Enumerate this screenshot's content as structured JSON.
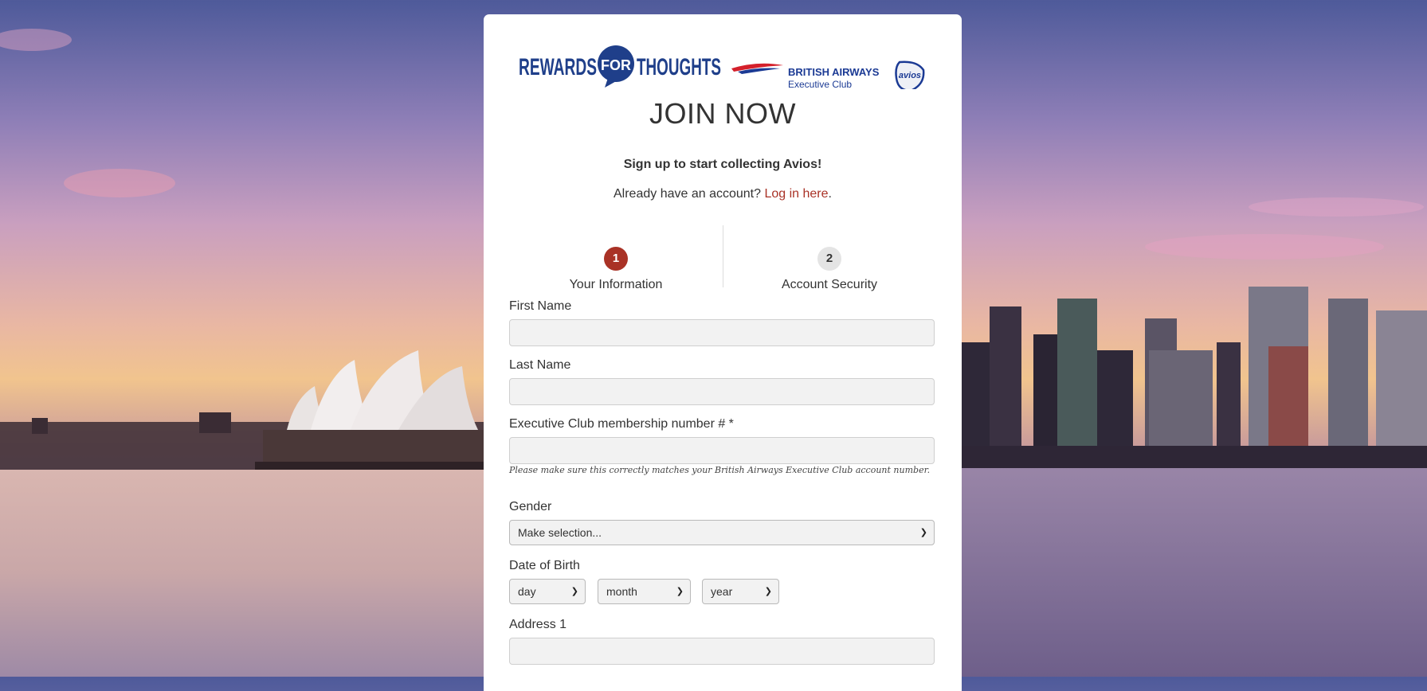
{
  "logos": {
    "rewards_left": "REWARDS",
    "rewards_mid": "FOR",
    "rewards_right": "THOUGHTS",
    "ba_name": "BRITISH AIRWAYS",
    "ba_club": "Executive Club",
    "avios": "avios"
  },
  "page": {
    "title": "JOIN NOW",
    "subtitle": "Sign up to start collecting Avios!",
    "login_prompt": "Already have an account?",
    "login_link": "Log in here",
    "login_suffix": "."
  },
  "steps": [
    {
      "number": "1",
      "label": "Your Information",
      "state": "active"
    },
    {
      "number": "2",
      "label": "Account Security",
      "state": "inactive"
    }
  ],
  "form": {
    "first_name": {
      "label": "First Name",
      "value": ""
    },
    "last_name": {
      "label": "Last Name",
      "value": ""
    },
    "membership": {
      "label": "Executive Club membership number # *",
      "value": "",
      "help": "Please make sure this correctly matches your British Airways Executive Club account number."
    },
    "gender": {
      "label": "Gender",
      "selected": "Make selection..."
    },
    "dob": {
      "label": "Date of Birth",
      "day": "day",
      "month": "month",
      "year": "year"
    },
    "address1": {
      "label": "Address 1",
      "value": ""
    }
  },
  "colors": {
    "accent": "#a93226",
    "rewards_blue": "#1f3f8a",
    "ba_blue": "#1b3a94",
    "ba_red": "#d4202b"
  }
}
